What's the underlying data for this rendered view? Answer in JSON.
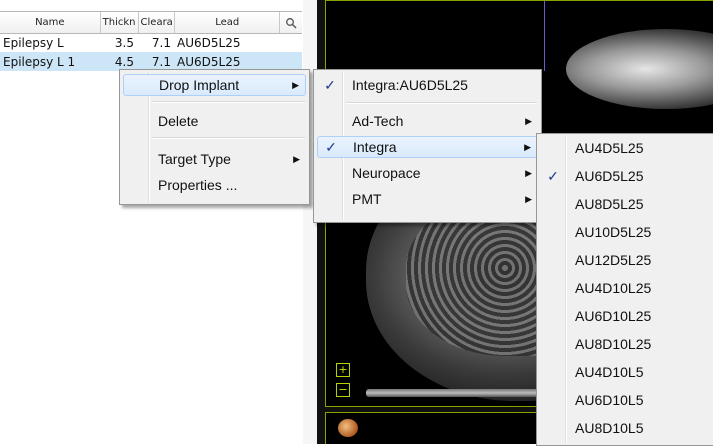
{
  "table": {
    "headers": {
      "name": "Name",
      "thickness": "Thickn",
      "clearance": "Cleara",
      "lead": "Lead"
    },
    "search_icon": "search-icon",
    "rows": [
      {
        "name": "Epilepsy L",
        "thickness": "3.5",
        "clearance": "7.1",
        "lead": "AU6D5L25"
      },
      {
        "name": "Epilepsy L 1",
        "thickness": "4.5",
        "clearance": "7.1",
        "lead": "AU6D5L25"
      }
    ]
  },
  "context_menu": {
    "items": {
      "drop_implant": "Drop Implant",
      "delete": "Delete",
      "target_type": "Target Type",
      "properties": "Properties ..."
    }
  },
  "implant_menu": {
    "current": "Integra:AU6D5L25",
    "vendors": [
      "Ad-Tech",
      "Integra",
      "Neuropace",
      "PMT"
    ],
    "checked_vendor": "Integra"
  },
  "lead_menu": {
    "items": [
      "AU4D5L25",
      "AU6D5L25",
      "AU8D5L25",
      "AU10D5L25",
      "AU12D5L25",
      "AU4D10L25",
      "AU6D10L25",
      "AU8D10L25",
      "AU4D10L5",
      "AU6D10L5",
      "AU8D10L5"
    ],
    "checked": "AU6D5L25"
  },
  "viewer": {
    "zoom_in": "+",
    "zoom_out": "−"
  },
  "colors": {
    "selection": "#cde6f7",
    "menu_bg": "#f0f0f0",
    "menu_hover": "#d9eafc",
    "viewer_border": "#8ca000",
    "checkmark": "#1a3c8a"
  }
}
